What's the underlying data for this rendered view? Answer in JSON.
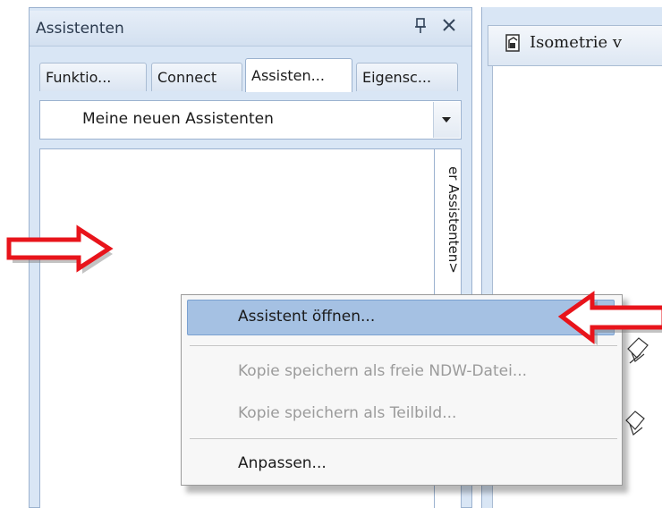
{
  "panel": {
    "title": "Assistenten",
    "pin_glyph": "p",
    "close_glyph": "✕"
  },
  "tabs": [
    {
      "label": "Funktio...",
      "active": false
    },
    {
      "label": "Connect",
      "active": false
    },
    {
      "label": "Assisten...",
      "active": true
    },
    {
      "label": "Eigensc...",
      "active": false
    }
  ],
  "dropdown": {
    "value": "Meine neuen Assistenten"
  },
  "list": {
    "vertical_label": "er Assistenten>"
  },
  "right_pane": {
    "tab_title": "Isometrie v"
  },
  "context_menu": {
    "items": [
      {
        "label": "Assistent öffnen...",
        "enabled": true,
        "highlighted": true
      },
      {
        "label": "Kopie speichern als freie NDW-Datei...",
        "enabled": false,
        "highlighted": false
      },
      {
        "label": "Kopie speichern als Teilbild...",
        "enabled": false,
        "highlighted": false
      },
      {
        "label": "Anpassen...",
        "enabled": true,
        "highlighted": false
      }
    ]
  },
  "colors": {
    "arrow_red": "#e8141b",
    "highlight": "#a5c1e3",
    "panel_bg": "#d9e6f5"
  },
  "icons": [
    "pin-icon",
    "close-icon",
    "chevron-down-icon",
    "document-icon",
    "red-arrow-right",
    "red-arrow-left"
  ]
}
